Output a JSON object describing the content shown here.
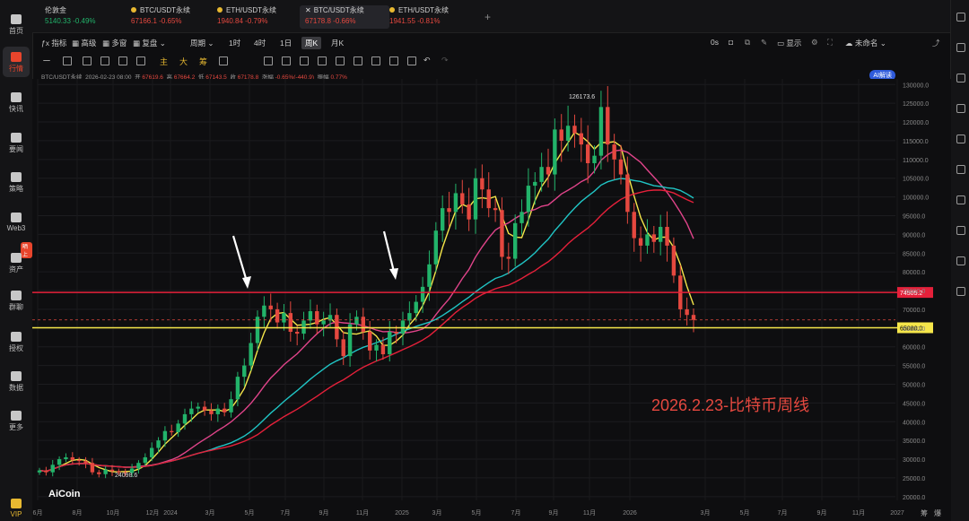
{
  "leftbar": {
    "items": [
      {
        "label": "首页",
        "icon": "home-icon"
      },
      {
        "label": "行情",
        "icon": "chart-bars-icon",
        "active": true
      },
      {
        "label": "快讯",
        "icon": "news-flash-icon"
      },
      {
        "label": "要闻",
        "icon": "document-icon"
      },
      {
        "label": "策略",
        "icon": "robot-icon"
      },
      {
        "label": "Web3",
        "icon": "web3-icon"
      },
      {
        "label": "资产",
        "icon": "wallet-icon"
      },
      {
        "label": "群聊",
        "icon": "chat-icon"
      },
      {
        "label": "授权",
        "icon": "key-icon"
      },
      {
        "label": "数据",
        "icon": "data-icon"
      },
      {
        "label": "更多",
        "icon": "grid-icon"
      },
      {
        "label": "VIP",
        "icon": "vip-icon"
      }
    ],
    "badge": "晒上"
  },
  "tabs": [
    {
      "name": "伦敦金",
      "price": "5140.33",
      "change": "-0.49%",
      "color": "#22b36a",
      "selected": false
    },
    {
      "name": "BTC/USDT永续",
      "price": "67166.1",
      "change": "-0.65%",
      "color": "#e5483f",
      "selected": false
    },
    {
      "name": "ETH/USDT永续",
      "price": "1940.84",
      "change": "-0.79%",
      "color": "#e5483f",
      "selected": false
    },
    {
      "name": "BTC/USDT永续",
      "price": "67178.8",
      "change": "-0.66%",
      "color": "#e5483f",
      "selected": true
    },
    {
      "name": "ETH/USDT永续",
      "price": "1941.55",
      "change": "-0.81%",
      "color": "#e5483f",
      "selected": false
    }
  ],
  "add_tab": "+",
  "toolbar": {
    "indicators": "指标",
    "advanced": "高级",
    "multi": "多窗",
    "depth": "复盘",
    "period": "周期",
    "periods": [
      "1时",
      "4时",
      "1日",
      "周K",
      "月K"
    ],
    "selected_period": "周K",
    "countdown": "0s",
    "display": "显示",
    "unnamed": "未命名",
    "ai": "AI解读"
  },
  "drawtools": {
    "text_tools": [
      "主",
      "大",
      "筹"
    ]
  },
  "info": {
    "symbol": "BTC/USDT永续",
    "date": "2026-02-23 08:00",
    "open_label": "开",
    "open": "67619.6",
    "high_label": "高",
    "high": "67664.2",
    "low_label": "低",
    "low": "67143.5",
    "close_label": "收",
    "close": "67178.8",
    "change_label": "涨幅",
    "change": "-0.65%(-440.9)",
    "amp_label": "振幅",
    "amp": "0.77%"
  },
  "annotation": "2026.2.23-比特币周线",
  "logo": "AiCoin",
  "bottom_right": [
    "筹",
    "爆"
  ],
  "colors": {
    "up": "#22b36a",
    "down": "#e5483f",
    "accent": "#e8452c",
    "yellow": "#f5e64a",
    "cyan": "#20c4c4",
    "magenta": "#e0448a"
  },
  "chart_data": {
    "type": "candlestick",
    "x_tick_labels": [
      "6月",
      "8月",
      "10月",
      "12月",
      "2024",
      "3月",
      "5月",
      "7月",
      "9月",
      "11月",
      "2025",
      "3月",
      "5月",
      "7月",
      "9月",
      "11月",
      "2026",
      "3月",
      "5月",
      "7月",
      "9月",
      "11月",
      "2027"
    ],
    "y_tick_labels": [
      "130000.0",
      "125000.0",
      "120000.0",
      "115000.0",
      "110000.0",
      "105000.0",
      "100000.0",
      "95000.0",
      "90000.0",
      "85000.0",
      "80000.0",
      "75000.0",
      "70000.0",
      "65000.0",
      "60000.0",
      "55000.0",
      "50000.0",
      "45000.0",
      "40000.0",
      "35000.0",
      "30000.0",
      "25000.0",
      "20000.0"
    ],
    "ylim": [
      19000,
      131500
    ],
    "horizontal_lines": [
      {
        "value": 74505.2,
        "label": "74505.2",
        "color": "#e5203a"
      },
      {
        "value": 65080.0,
        "label": "65080.0",
        "color": "#f5e64a"
      }
    ],
    "high_label": "126173.6",
    "low_label": "24098.6",
    "closes": [
      27000,
      26500,
      28500,
      30000,
      30500,
      29800,
      29500,
      29000,
      26500,
      26000,
      27200,
      26800,
      26500,
      26300,
      27500,
      29000,
      30500,
      33000,
      35000,
      37500,
      37200,
      39500,
      42000,
      43500,
      44000,
      43000,
      42000,
      43500,
      42500,
      46000,
      52000,
      55000,
      61000,
      68000,
      71000,
      70000,
      66500,
      69000,
      64000,
      63500,
      67000,
      69500,
      66000,
      67000,
      68500,
      62000,
      57500,
      66000,
      68000,
      64000,
      59000,
      60500,
      58000,
      64000,
      63500,
      67000,
      69000,
      72000,
      76000,
      82000,
      91000,
      97000,
      96000,
      101000,
      98000,
      94000,
      105000,
      102000,
      97000,
      96500,
      84000,
      83500,
      93000,
      96000,
      103000,
      104000,
      108000,
      106000,
      118000,
      115000,
      119000,
      117000,
      114000,
      109000,
      111000,
      124000,
      114000,
      110000,
      106000,
      96000,
      89000,
      87000,
      90000,
      88000,
      92000,
      87000,
      79000,
      70000,
      68500,
      67178
    ]
  }
}
